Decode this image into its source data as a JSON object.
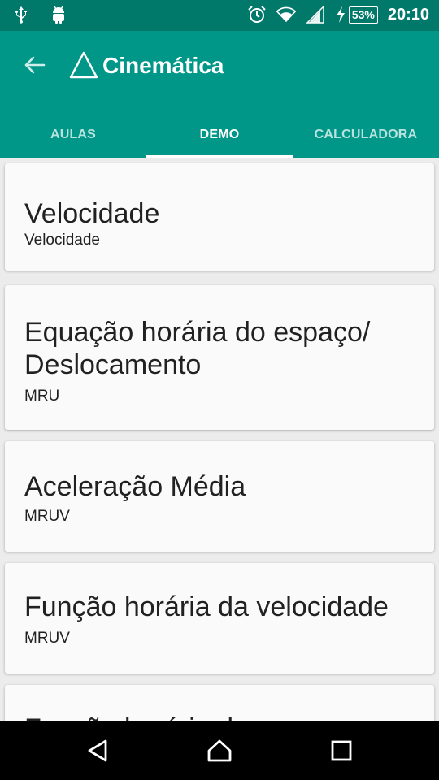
{
  "status_bar": {
    "icons": [
      "usb-icon",
      "android-debug-icon",
      "alarm-icon",
      "wifi-icon",
      "signal-icon",
      "charging-icon"
    ],
    "battery": "53%",
    "time": "20:10"
  },
  "app_bar": {
    "title": "Cinemática",
    "back_icon": "arrow-back-icon",
    "logo_icon": "triangle-logo-icon",
    "color": "#009688",
    "status_color": "#00796b"
  },
  "tabs": [
    {
      "label": "AULAS",
      "active": false
    },
    {
      "label": "DEMO",
      "active": true
    },
    {
      "label": "CALCULADORA",
      "active": false
    }
  ],
  "cards": [
    {
      "title": "Velocidade",
      "subtitle": "Velocidade"
    },
    {
      "title": "Equação horária do espaço/ Deslocamento",
      "subtitle": "MRU"
    },
    {
      "title": "Aceleração Média",
      "subtitle": "MRUV"
    },
    {
      "title": "Função horária da velocidade",
      "subtitle": "MRUV"
    },
    {
      "title": "Função horária do espaço",
      "subtitle": ""
    }
  ],
  "nav_bar": {
    "icons": [
      "back-triangle-icon",
      "home-icon",
      "recents-square-icon"
    ]
  }
}
